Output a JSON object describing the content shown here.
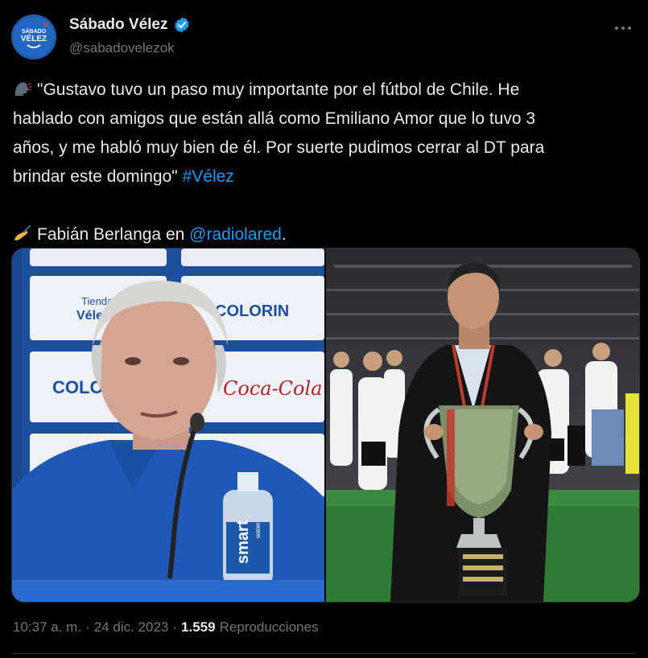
{
  "author": {
    "display_name": "Sábado Vélez",
    "handle": "@sabadovelezok",
    "verified": true,
    "avatar_text_top": "SÁBADO",
    "avatar_text_bottom": "VÉLEZ"
  },
  "tweet": {
    "line1": "\"Gustavo tuvo un paso muy importante por el fútbol de Chile. He",
    "line2": "hablado con amigos que están allá como Emiliano Amor que lo tuvo 3",
    "line3": "años, y me habló muy bien de él. Por suerte pudimos cerrar al DT para",
    "line4_text": "brindar este domingo\" ",
    "hashtag": "#Vélez",
    "credit_text": "Fabián Berlanga en ",
    "mention": "@radiolared",
    "credit_end": ".",
    "speaker_emoji_icon": "speaking-head-icon",
    "writing_emoji_icon": "writing-hand-icon"
  },
  "media": {
    "left_sponsors": [
      "Tienda",
      "Vélez",
      "COLORIN",
      "COLO",
      "Coca-Cola"
    ],
    "bottle_brand": "smart",
    "bottle_sub": "water"
  },
  "meta": {
    "time": "10:37 a. m.",
    "sep1": "·",
    "date": "24 dic. 2023",
    "sep2": "·",
    "views_count": "1.559",
    "views_label": "Reproducciones"
  },
  "colors": {
    "background": "#000000",
    "text": "#e7e9ea",
    "secondary": "#71767b",
    "link": "#1d9bf0",
    "verified": "#1d9bf0"
  }
}
